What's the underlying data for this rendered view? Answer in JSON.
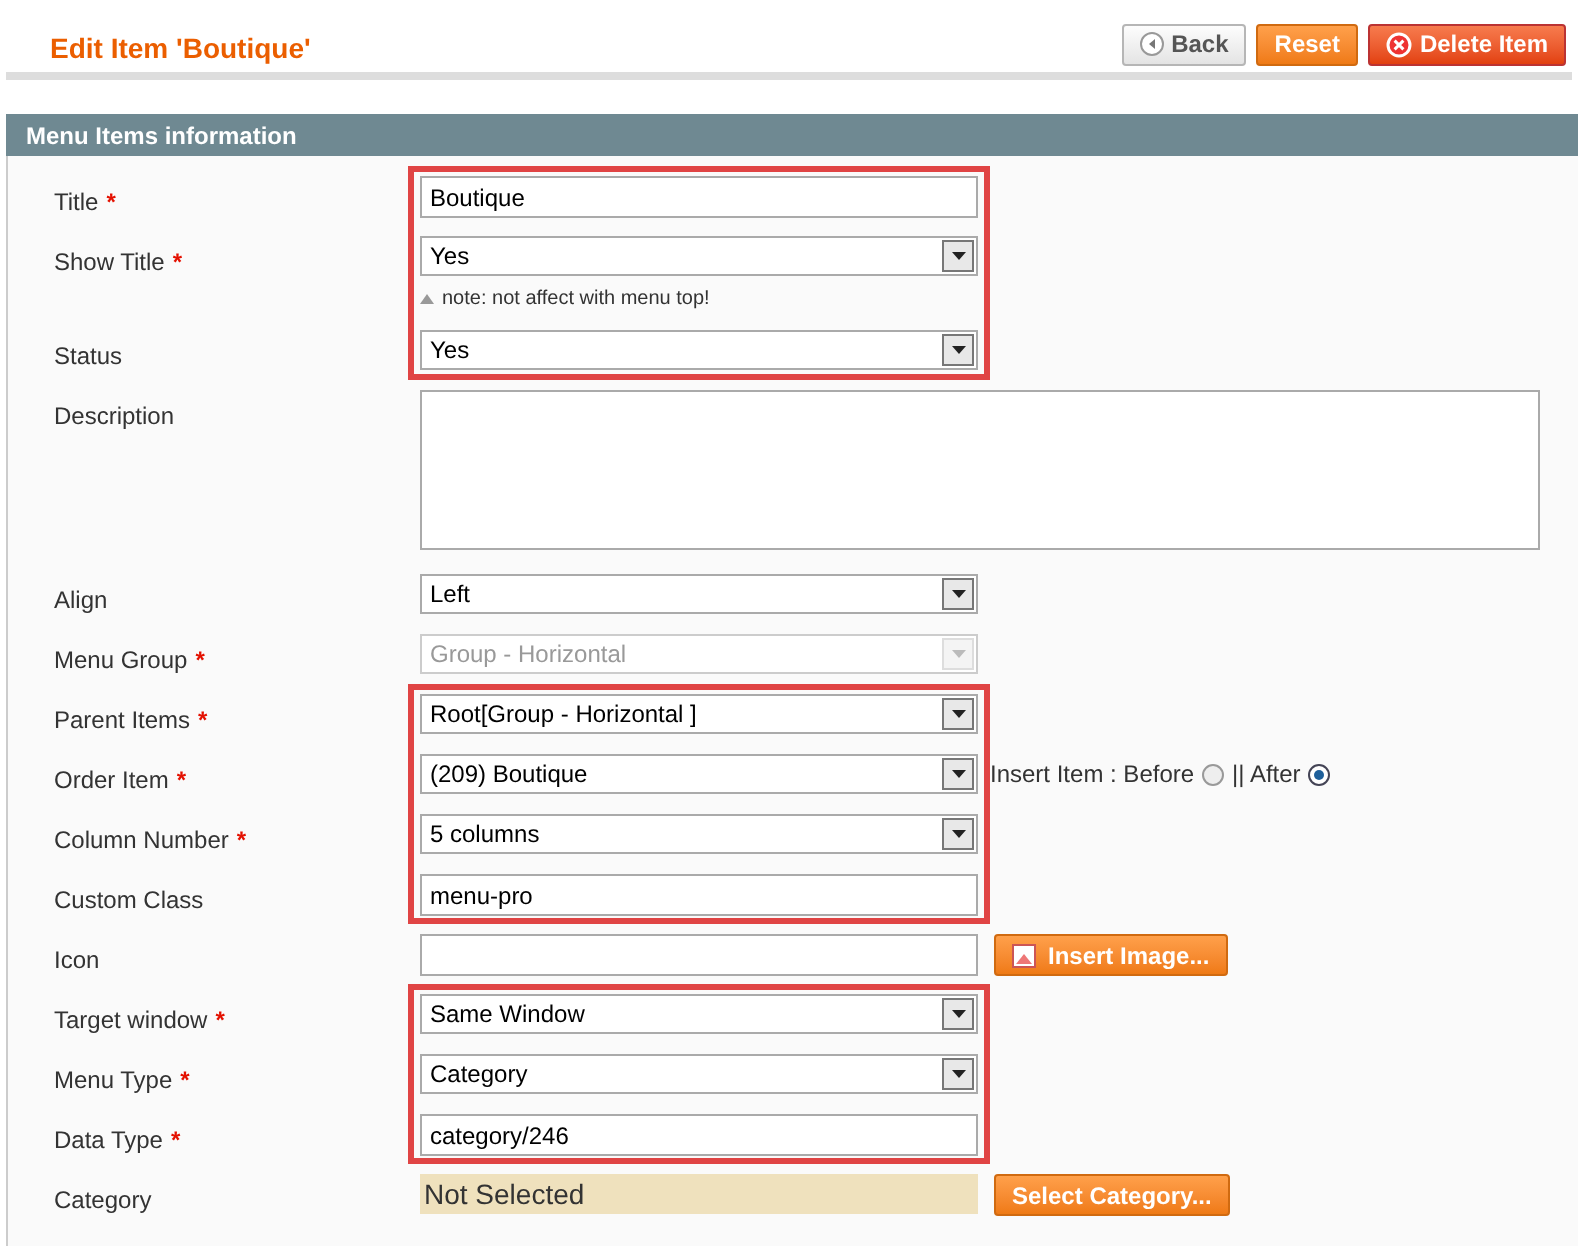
{
  "header": {
    "title": "Edit Item 'Boutique'",
    "buttons": [
      {
        "label": "Back",
        "kind": "back"
      },
      {
        "label": "Reset",
        "kind": "plain"
      },
      {
        "label": "Delete Item",
        "kind": "delete"
      }
    ]
  },
  "section_title": "Menu Items information",
  "groups": [
    {
      "highlighted": true,
      "rows": [
        {
          "label": "Title",
          "required_mark": "*",
          "kind": "text",
          "value": "Boutique"
        },
        {
          "label": "Show Title",
          "required_mark": "*",
          "kind": "select",
          "value": "Yes",
          "disabled": false,
          "note": "note: not affect with menu top!"
        },
        {
          "label": "Status",
          "kind": "select",
          "value": "Yes",
          "disabled": false
        }
      ]
    },
    {
      "highlighted": false,
      "rows": [
        {
          "label": "Description",
          "kind": "textarea"
        },
        {
          "label": "Align",
          "kind": "select",
          "value": "Left",
          "disabled": false
        },
        {
          "label": "Menu Group",
          "required_mark": "*",
          "kind": "select",
          "value": "Group - Horizontal",
          "disabled": true
        }
      ]
    },
    {
      "highlighted": true,
      "rows": [
        {
          "label": "Parent Items",
          "required_mark": "*",
          "kind": "select",
          "value": "Root[Group - Horizontal ]",
          "disabled": false
        },
        {
          "label": "Order Item",
          "required_mark": "*",
          "kind": "select",
          "value": "(209) Boutique",
          "disabled": false,
          "insert": {
            "label": "Insert Item : Before",
            "options": [
              {
                "selected": false
              },
              {
                "label": "|| After",
                "selected": true
              }
            ]
          }
        },
        {
          "label": "Column Number",
          "required_mark": "*",
          "kind": "select",
          "value": "5 columns",
          "disabled": false
        },
        {
          "label": "Custom Class",
          "kind": "text",
          "value": "menu-pro"
        }
      ]
    },
    {
      "highlighted": false,
      "rows": [
        {
          "label": "Icon",
          "kind": "text",
          "button": "Insert Image..."
        }
      ]
    },
    {
      "highlighted": true,
      "rows": [
        {
          "label": "Target window",
          "required_mark": "*",
          "kind": "select",
          "value": "Same Window",
          "disabled": false
        },
        {
          "label": "Menu Type",
          "required_mark": "*",
          "kind": "select",
          "value": "Category",
          "disabled": false
        },
        {
          "label": "Data Type",
          "required_mark": "*",
          "kind": "text",
          "value": "category/246"
        }
      ]
    },
    {
      "highlighted": false,
      "rows": [
        {
          "label": "Category",
          "kind": "static",
          "value": "Not Selected",
          "button": "Select Category..."
        }
      ]
    }
  ]
}
